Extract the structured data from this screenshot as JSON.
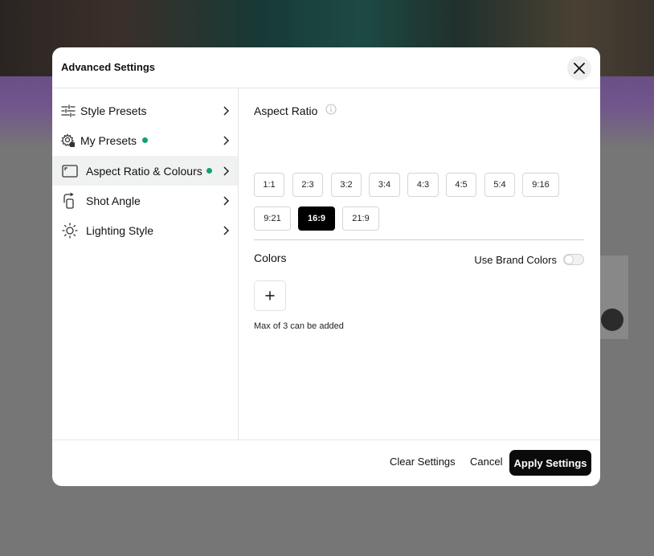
{
  "dialog": {
    "title": "Advanced Settings",
    "close_icon": "close-icon"
  },
  "sidebar": {
    "items": [
      {
        "label": "Style Presets",
        "icon": "sliders-icon",
        "has_dot": false,
        "active": false
      },
      {
        "label": "My Presets",
        "icon": "presets-gear-icon",
        "has_dot": true,
        "active": false
      },
      {
        "label": "Aspect Ratio & Colours",
        "icon": "aspect-ratio-icon",
        "has_dot": true,
        "active": true
      },
      {
        "label": "Shot Angle",
        "icon": "camera-rotate-icon",
        "has_dot": false,
        "active": false
      },
      {
        "label": "Lighting Style",
        "icon": "sun-icon",
        "has_dot": false,
        "active": false
      }
    ],
    "dot_color": "#12a26a"
  },
  "aspect_ratio": {
    "title": "Aspect Ratio",
    "info_icon": "info-icon",
    "options": [
      "1:1",
      "2:3",
      "3:2",
      "3:4",
      "4:3",
      "4:5",
      "5:4",
      "9:16",
      "9:21",
      "16:9",
      "21:9"
    ],
    "selected": "16:9"
  },
  "colors": {
    "title": "Colors",
    "brand_label": "Use Brand Colors",
    "brand_enabled": false,
    "add_icon": "plus-icon",
    "hint": "Max of 3 can be added"
  },
  "footer": {
    "clear_label": "Clear Settings",
    "cancel_label": "Cancel",
    "apply_label": "Apply Settings"
  }
}
